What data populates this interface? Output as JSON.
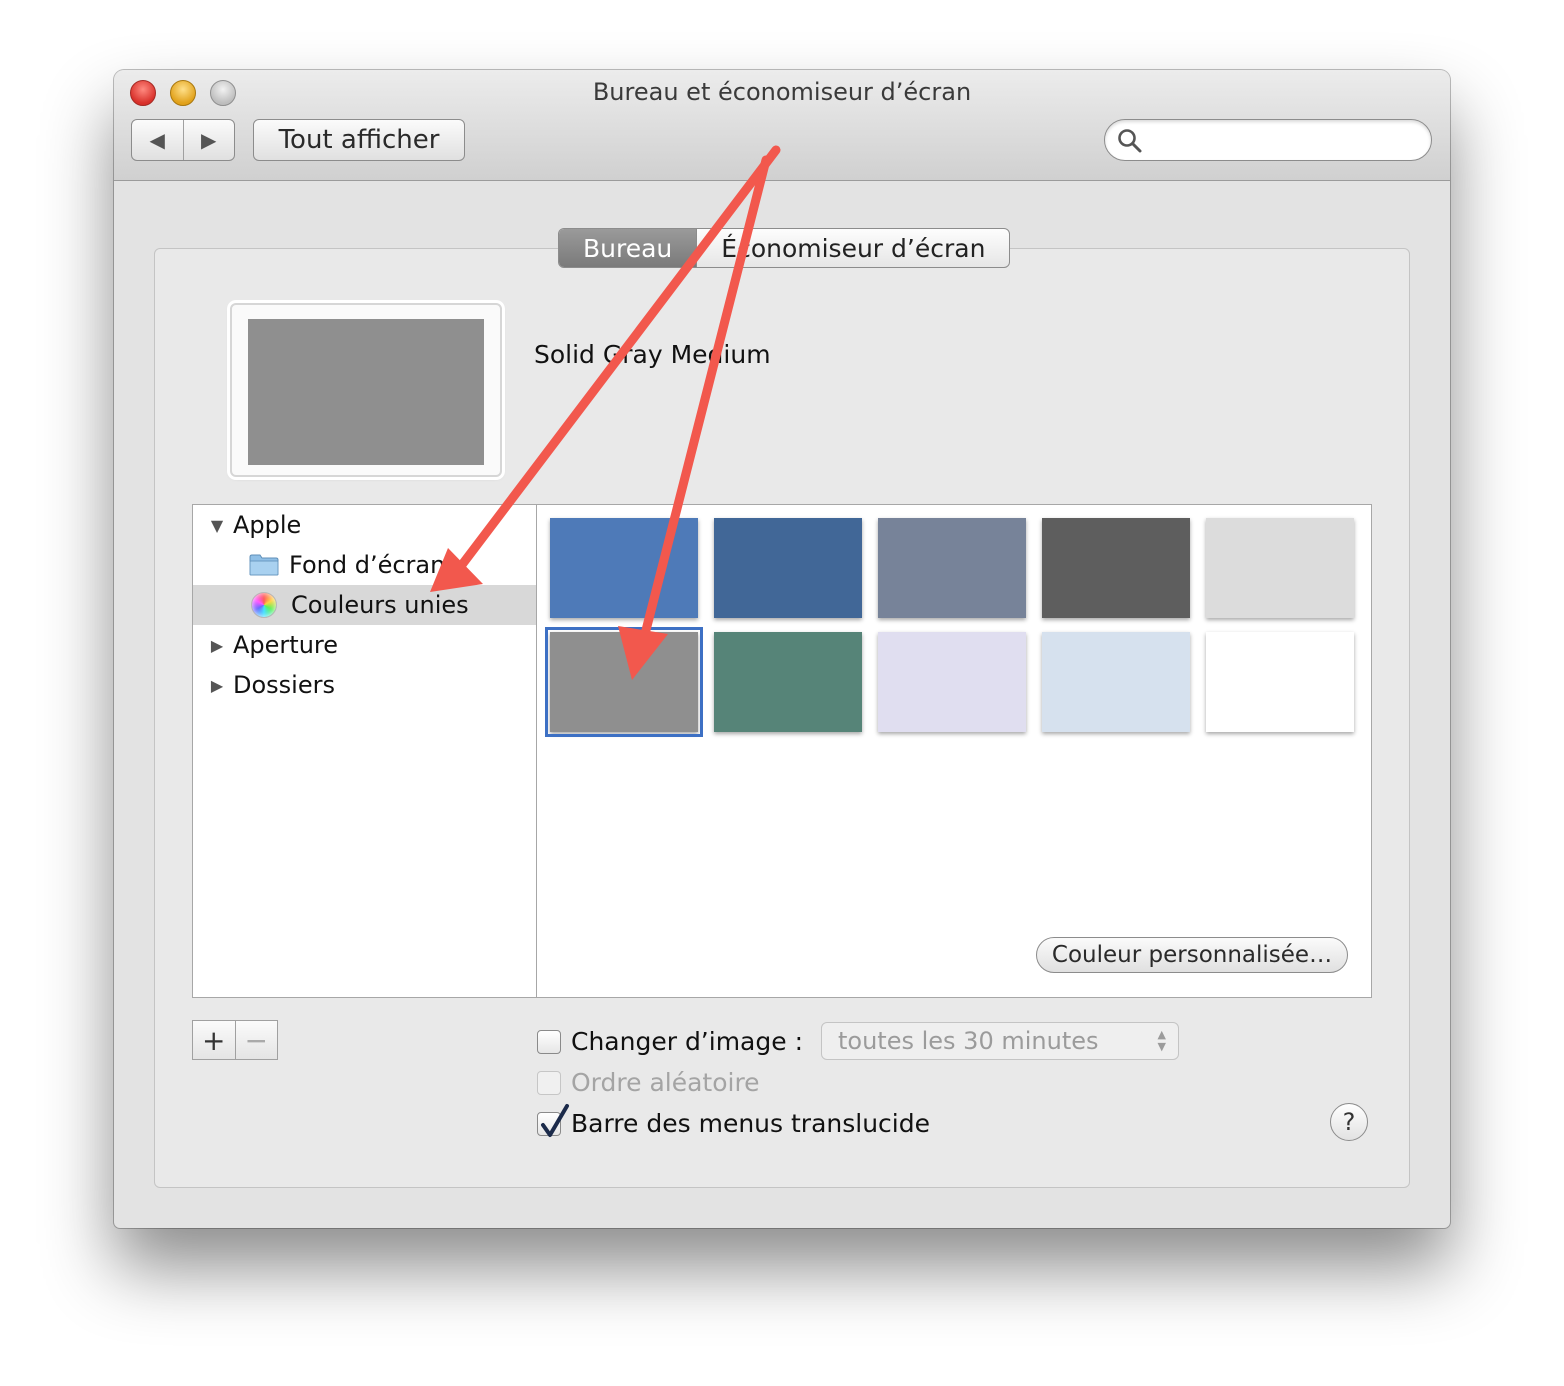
{
  "window": {
    "title": "Bureau et économiseur d’écran"
  },
  "toolbar": {
    "back_icon": "chevron-left",
    "forward_icon": "chevron-right",
    "show_all_label": "Tout afficher",
    "search_placeholder": "",
    "search_icon": "magnifier"
  },
  "tabs": [
    {
      "label": "Bureau",
      "selected": true
    },
    {
      "label": "Économiseur d’écran",
      "selected": false
    }
  ],
  "preview": {
    "current_color": "#8f8f8f",
    "name": "Solid Gray Medium"
  },
  "sources": [
    {
      "label": "Apple",
      "disclosure": "expanded",
      "level": 0
    },
    {
      "label": "Fond d’écran",
      "icon": "folder",
      "level": 1
    },
    {
      "label": "Couleurs unies",
      "icon": "color-wheel",
      "level": 1,
      "selected": true
    },
    {
      "label": "Aperture",
      "disclosure": "collapsed",
      "level": 0
    },
    {
      "label": "Dossiers",
      "disclosure": "collapsed",
      "level": 0
    }
  ],
  "swatches": [
    {
      "color": "#4e7ab8"
    },
    {
      "color": "#416797"
    },
    {
      "color": "#778399"
    },
    {
      "color": "#5e5e5e"
    },
    {
      "color": "#dcdcdc"
    },
    {
      "color": "#8f8f8f",
      "selected": true
    },
    {
      "color": "#568478"
    },
    {
      "color": "#e0def0"
    },
    {
      "color": "#d6e1ee"
    },
    {
      "color": "#ffffff"
    }
  ],
  "custom_color_label": "Couleur personnalisée…",
  "options": {
    "change_picture": {
      "label": "Changer d’image :",
      "checked": false
    },
    "interval_value": "toutes les 30 minutes",
    "random_order": {
      "label": "Ordre aléatoire",
      "checked": false,
      "enabled": false
    },
    "translucent_menu": {
      "label": "Barre des menus translucide",
      "checked": true
    }
  },
  "add_label": "+",
  "remove_label": "−",
  "help_label": "?",
  "annotation_color": "#f2584d"
}
